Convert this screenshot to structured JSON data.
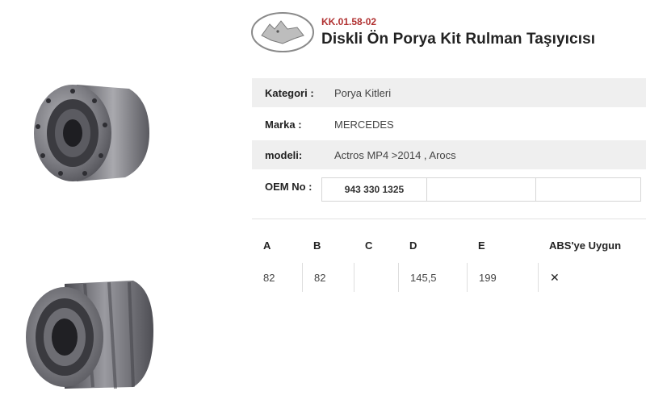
{
  "product": {
    "code": "KK.01.58-02",
    "title": "Diskli Ön Porya Kit Rulman Taşıyıcısı"
  },
  "specs": [
    {
      "label": "Kategori :",
      "value": "Porya Kitleri"
    },
    {
      "label": "Marka :",
      "value": "MERCEDES"
    },
    {
      "label": "modeli:",
      "value": "Actros MP4 >2014 , Arocs"
    }
  ],
  "oem": {
    "label": "OEM No :",
    "values": [
      "943 330 1325",
      "",
      ""
    ]
  },
  "dimensions": {
    "headers": [
      "A",
      "B",
      "C",
      "D",
      "E",
      "ABS'ye Uygun"
    ],
    "values": [
      "82",
      "82",
      "",
      "145,5",
      "199",
      ""
    ],
    "abs_icon": "cross-icon"
  },
  "colors": {
    "code": "#b03030",
    "row_shade": "#efefef"
  }
}
